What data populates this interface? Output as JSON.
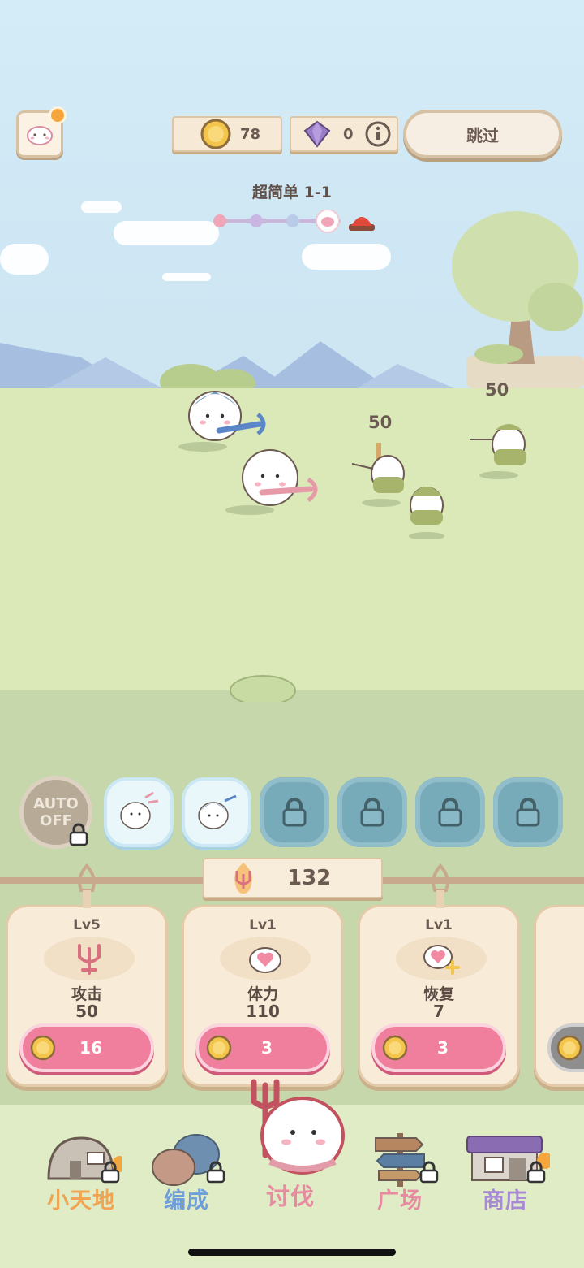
{
  "top": {
    "coins": "78",
    "gems": "0",
    "skip_label": "跳过",
    "info_icon": "info-icon"
  },
  "stage": {
    "title": "超简单 1-1"
  },
  "battle": {
    "damage_numbers": [
      "50",
      "50"
    ]
  },
  "skills": {
    "auto_line1": "AUTO",
    "auto_line2": "OFF"
  },
  "power": {
    "value": "132"
  },
  "upgrades": [
    {
      "level": "Lv5",
      "name": "攻击",
      "value": "50",
      "cost": "16"
    },
    {
      "level": "Lv1",
      "name": "体力",
      "value": "110",
      "cost": "3"
    },
    {
      "level": "Lv1",
      "name": "恢复",
      "value": "7",
      "cost": "3"
    }
  ],
  "nav": [
    {
      "label": "小天地",
      "color": "#f0a553"
    },
    {
      "label": "编成",
      "color": "#6f9ed8"
    },
    {
      "label": "讨伐",
      "color": "#e88aa0"
    },
    {
      "label": "广场",
      "color": "#e88aa0"
    },
    {
      "label": "商店",
      "color": "#a889d6"
    }
  ],
  "colors": {
    "accent_pink": "#ef7f9c",
    "plank": "#f6e9d6",
    "field": "#dbe8b8"
  }
}
